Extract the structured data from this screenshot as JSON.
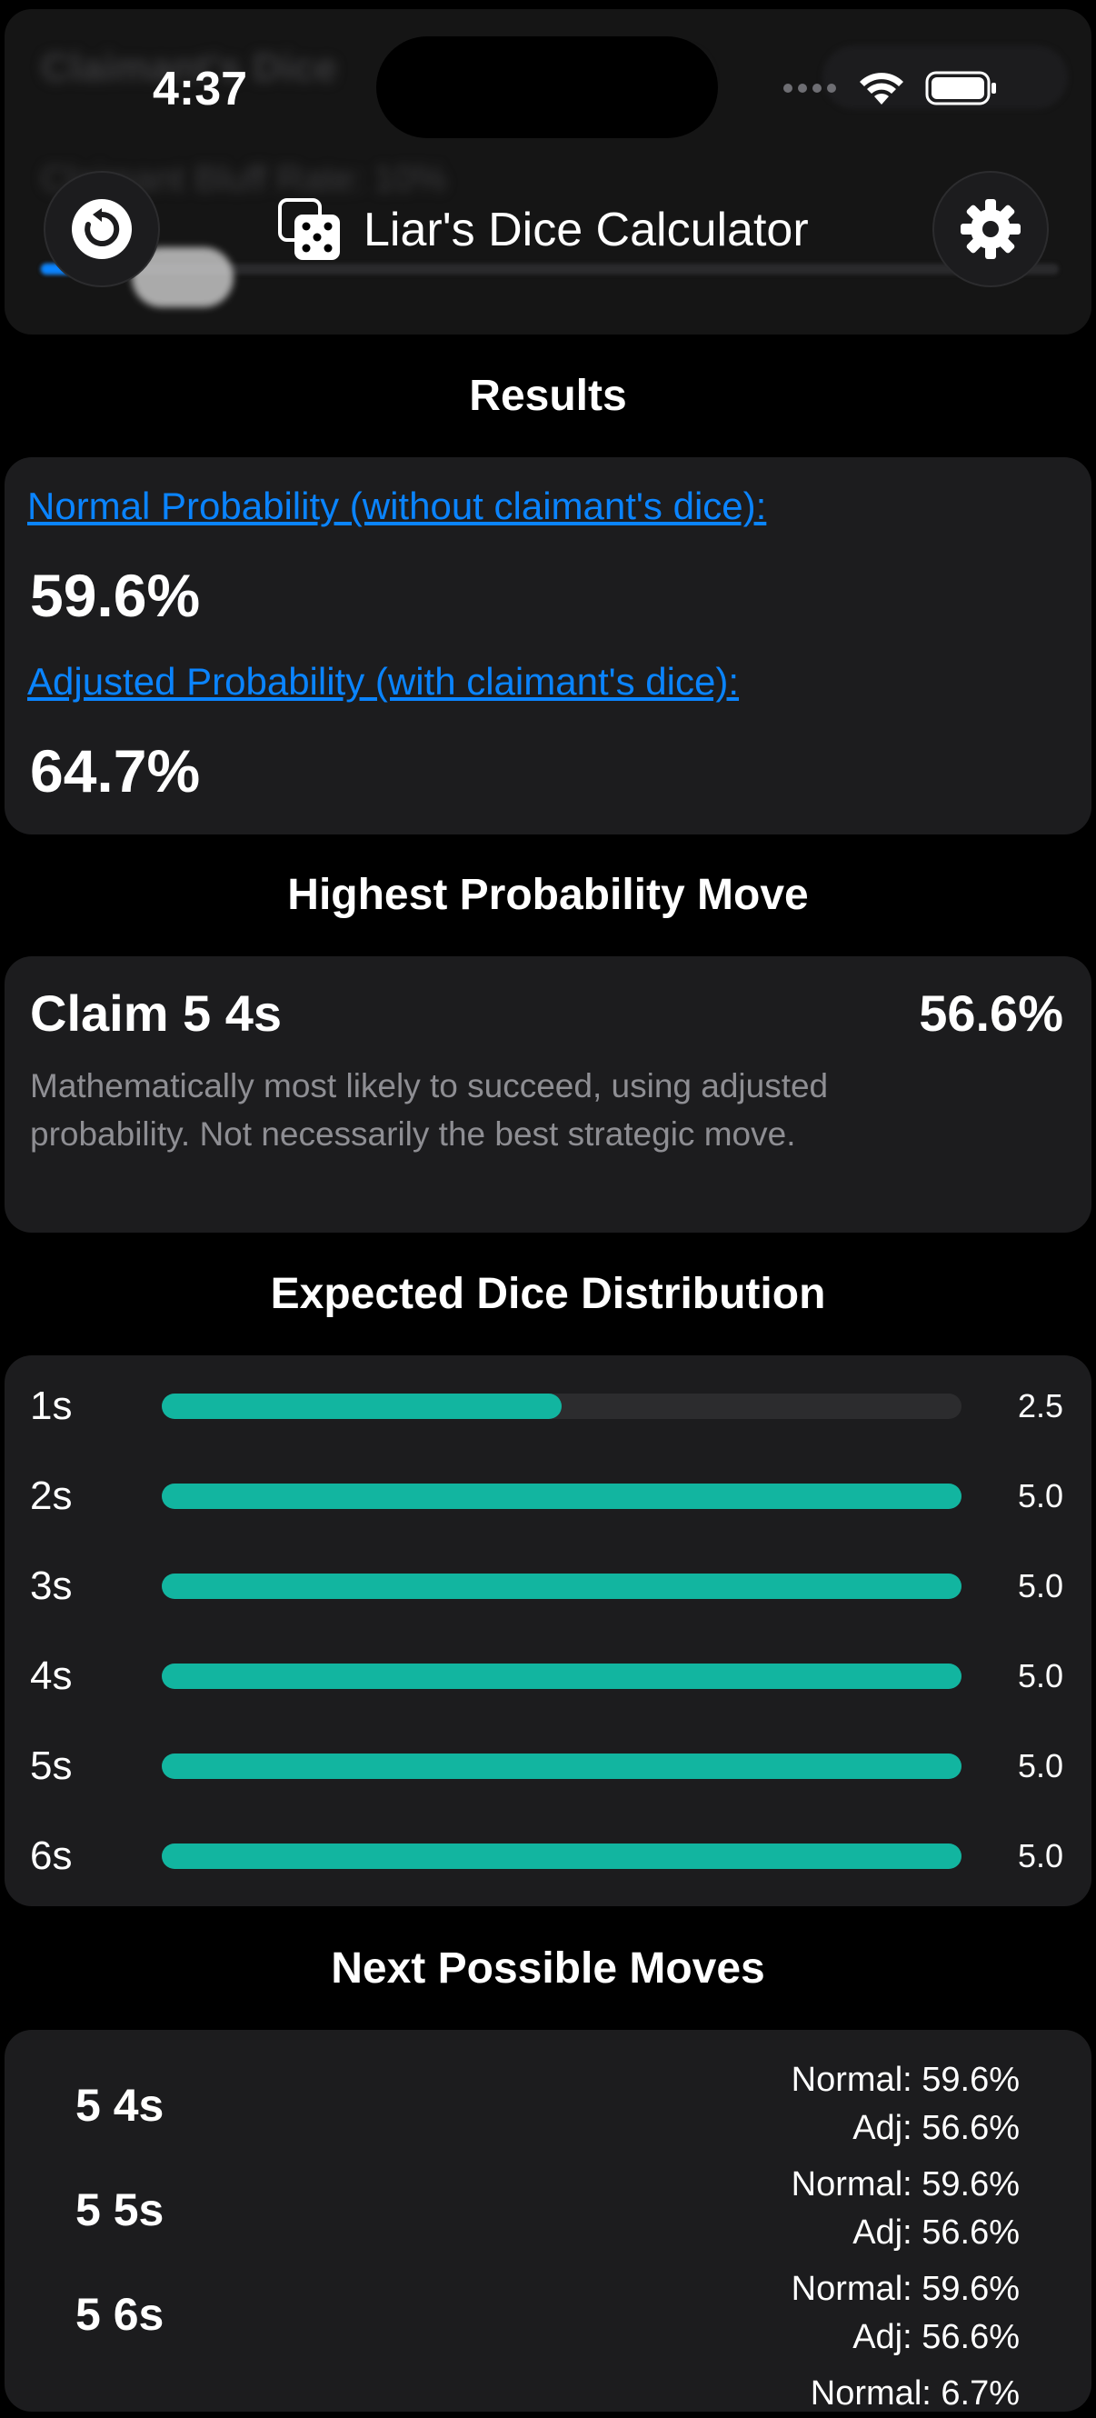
{
  "status_bar": {
    "time": "4:37"
  },
  "header": {
    "title": "Liar's Dice Calculator",
    "ghost_title": "Claimant's Dice",
    "ghost_subtitle": "Claimant Bluff Rate: 10%"
  },
  "results": {
    "section_title": "Results",
    "normal_label": "Normal Probability (without claimant's dice):",
    "normal_value": "59.6%",
    "adjusted_label": "Adjusted Probability (with claimant's dice):",
    "adjusted_value": "64.7%"
  },
  "highest_move": {
    "section_title": "Highest Probability Move",
    "claim": "Claim 5 4s",
    "probability": "56.6%",
    "description": "Mathematically most likely to succeed, using adjusted probability. Not necessarily the best strategic move."
  },
  "distribution": {
    "section_title": "Expected Dice Distribution",
    "max": 5.0,
    "rows": [
      {
        "label": "1s",
        "value": 2.5,
        "display": "2.5"
      },
      {
        "label": "2s",
        "value": 5.0,
        "display": "5.0"
      },
      {
        "label": "3s",
        "value": 5.0,
        "display": "5.0"
      },
      {
        "label": "4s",
        "value": 5.0,
        "display": "5.0"
      },
      {
        "label": "5s",
        "value": 5.0,
        "display": "5.0"
      },
      {
        "label": "6s",
        "value": 5.0,
        "display": "5.0"
      }
    ]
  },
  "next_moves": {
    "section_title": "Next Possible Moves",
    "items": [
      {
        "move": "5 4s",
        "normal": "Normal: 59.6%",
        "adj": "Adj: 56.6%"
      },
      {
        "move": "5 5s",
        "normal": "Normal: 59.6%",
        "adj": "Adj: 56.6%"
      },
      {
        "move": "5 6s",
        "normal": "Normal: 59.6%",
        "adj": "Adj: 56.6%"
      },
      {
        "move": "",
        "normal": "Normal: 6.7%",
        "adj": ""
      }
    ]
  },
  "colors": {
    "accent": "#0a84ff",
    "bar": "#12b5a0",
    "card": "#1c1c1e"
  },
  "icons": {
    "reset": "reset-icon",
    "dice": "dice-icon",
    "settings": "gear-icon"
  }
}
